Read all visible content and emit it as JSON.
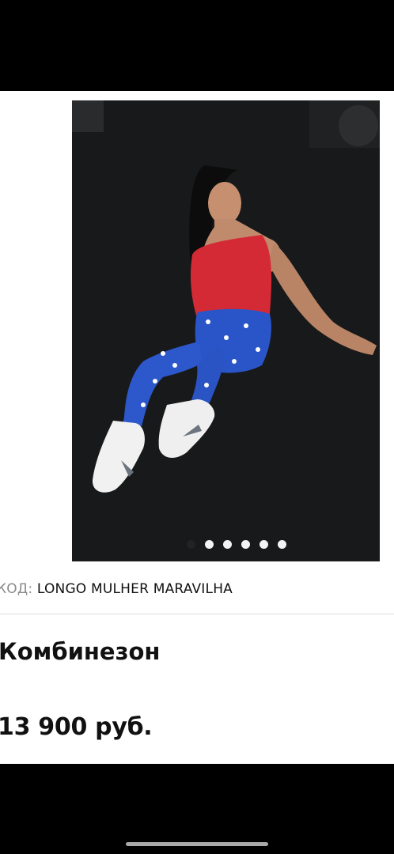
{
  "product": {
    "sku_label": "КОД:",
    "sku_value": "LONGO MULHER MARAVILHA",
    "title": "Комбинезон",
    "price": "13 900 руб."
  },
  "gallery": {
    "image_icon": "product-photo",
    "dot_count": 6,
    "active_index": 0
  },
  "colors": {
    "background": "#ffffff",
    "text": "#111111",
    "muted": "#8a8a8a",
    "system_bars": "#000000"
  }
}
